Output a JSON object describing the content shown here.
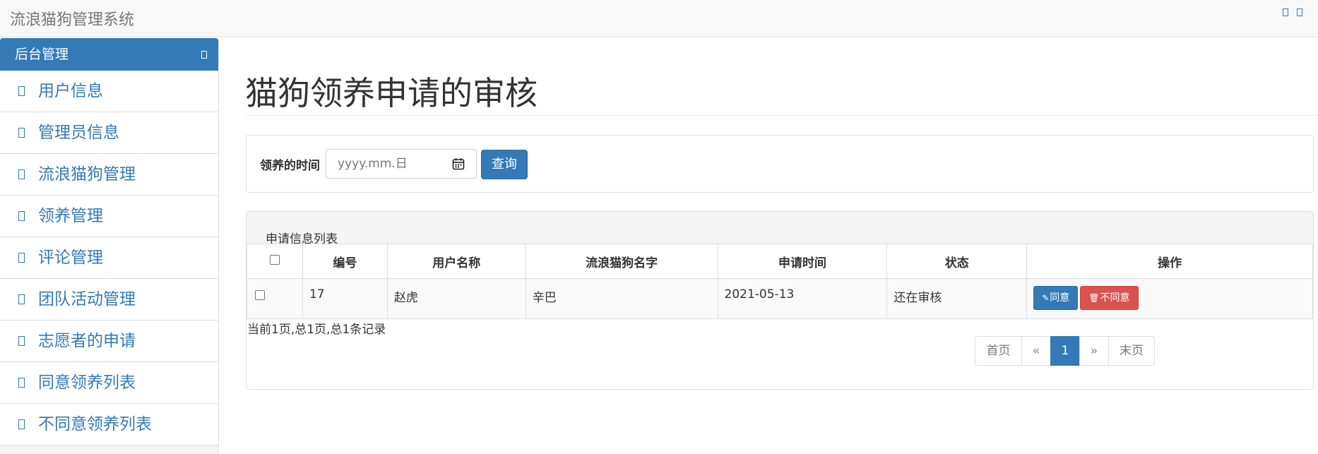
{
  "app": {
    "title": "流浪猫狗管理系统"
  },
  "sidebar": {
    "header": "后台管理",
    "items": [
      {
        "label": "用户信息"
      },
      {
        "label": "管理员信息"
      },
      {
        "label": "流浪猫狗管理"
      },
      {
        "label": "领养管理"
      },
      {
        "label": "评论管理"
      },
      {
        "label": "团队活动管理"
      },
      {
        "label": "志愿者的申请"
      },
      {
        "label": "同意领养列表"
      },
      {
        "label": "不同意领养列表"
      }
    ]
  },
  "main": {
    "title": "猫狗领养申请的审核",
    "search": {
      "label": "领养的时间",
      "placeholder": "yyyy.mm.日",
      "button": "查询"
    },
    "list": {
      "heading": "申请信息列表",
      "columns": [
        "编号",
        "用户名称",
        "流浪猫狗名字",
        "申请时间",
        "状态",
        "操作"
      ],
      "rows": [
        {
          "id": "17",
          "user": "赵虎",
          "pet": "辛巴",
          "date": "2021-05-13",
          "status": "还在审核",
          "agree": "同意",
          "reject": "不同意"
        }
      ],
      "page_info": "当前1页,总1页,总1条记录",
      "pager": {
        "first": "首页",
        "prev": "«",
        "current": "1",
        "next": "»",
        "last": "末页"
      }
    }
  },
  "colors": {
    "primary": "#337ab7",
    "danger": "#d9534f"
  }
}
